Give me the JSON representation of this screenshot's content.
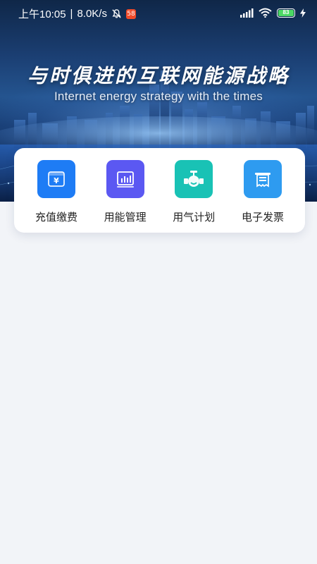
{
  "status_bar": {
    "time": "上午10:05",
    "separator": "|",
    "speed": "8.0K/s",
    "app_badge": "58",
    "battery": "83"
  },
  "banner": {
    "title": "与时俱进的互联网能源战略",
    "subtitle": "Internet energy strategy with the times"
  },
  "menu": {
    "items": [
      {
        "label": "充值缴费",
        "icon": "payment-yen-icon",
        "color": "#1E7CF5"
      },
      {
        "label": "用能管理",
        "icon": "energy-chart-icon",
        "color": "#5B58F2"
      },
      {
        "label": "用气计划",
        "icon": "gas-valve-icon",
        "color": "#19C2B5"
      },
      {
        "label": "电子发票",
        "icon": "invoice-icon",
        "color": "#2E9BF0"
      }
    ]
  },
  "colors": {
    "page_background": "#F2F4F8",
    "card_background": "#FFFFFF"
  }
}
